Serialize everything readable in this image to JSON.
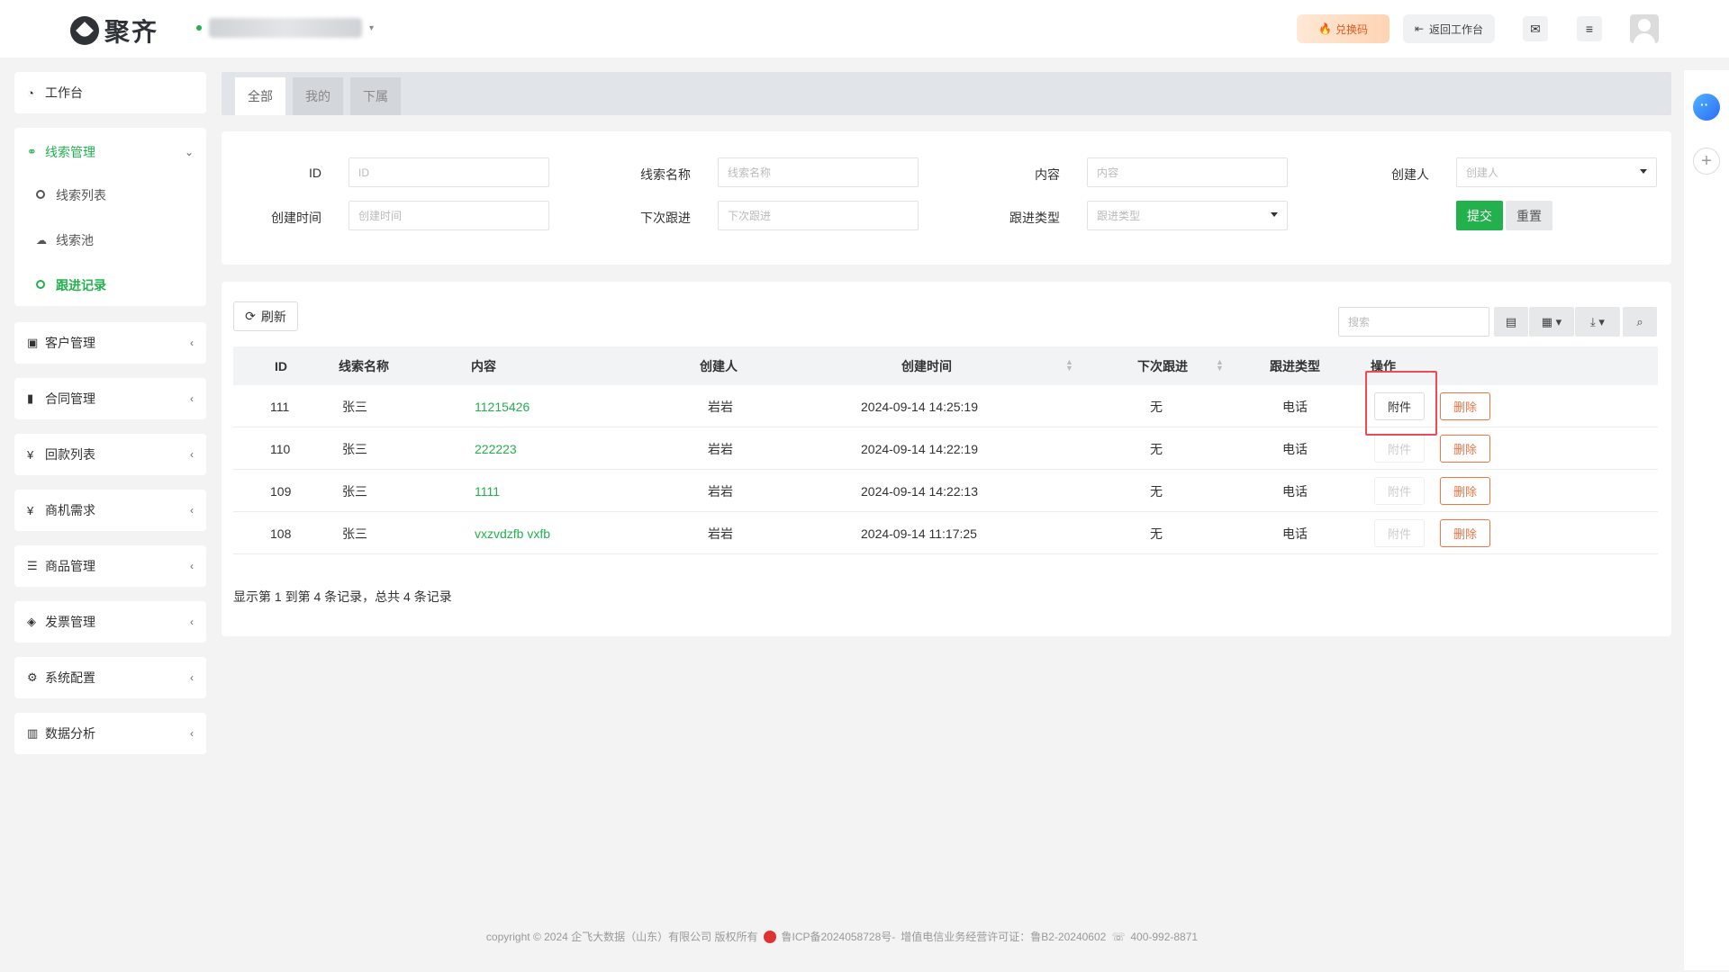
{
  "header": {
    "brand": "聚齐",
    "redeem_label": "兑换码",
    "back_label": "返回工作台"
  },
  "sidebar": {
    "workbench": "工作台",
    "leads": "线索管理",
    "leads_sub": [
      "线索列表",
      "线索池",
      "跟进记录"
    ],
    "groups": [
      "客户管理",
      "合同管理",
      "回款列表",
      "商机需求",
      "商品管理",
      "发票管理",
      "系统配置",
      "数据分析"
    ]
  },
  "tabs": [
    "全部",
    "我的",
    "下属"
  ],
  "filter": {
    "id_label": "ID",
    "id_placeholder": "ID",
    "name_label": "线索名称",
    "name_placeholder": "线索名称",
    "content_label": "内容",
    "content_placeholder": "内容",
    "creator_label": "创建人",
    "creator_placeholder": "创建人",
    "created_label": "创建时间",
    "created_placeholder": "创建时间",
    "next_label": "下次跟进",
    "next_placeholder": "下次跟进",
    "type_label": "跟进类型",
    "type_placeholder": "跟进类型",
    "submit": "提交",
    "reset": "重置"
  },
  "toolbar": {
    "refresh": "刷新",
    "search_placeholder": "搜索"
  },
  "table": {
    "columns": [
      "ID",
      "线索名称",
      "内容",
      "创建人",
      "创建时间",
      "下次跟进",
      "跟进类型",
      "操作"
    ],
    "rows": [
      {
        "id": "111",
        "name": "张三",
        "content": "11215426",
        "creator": "岩岩",
        "created": "2024-09-14 14:25:19",
        "next": "无",
        "type": "电话",
        "attach": "附件",
        "delete": "删除"
      },
      {
        "id": "110",
        "name": "张三",
        "content": "222223",
        "creator": "岩岩",
        "created": "2024-09-14 14:22:19",
        "next": "无",
        "type": "电话",
        "attach": "附件",
        "delete": "删除"
      },
      {
        "id": "109",
        "name": "张三",
        "content": "1111",
        "creator": "岩岩",
        "created": "2024-09-14 14:22:13",
        "next": "无",
        "type": "电话",
        "attach": "附件",
        "delete": "删除"
      },
      {
        "id": "108",
        "name": "张三",
        "content": "vxzvdzfb vxfb",
        "creator": "岩岩",
        "created": "2024-09-14 11:17:25",
        "next": "无",
        "type": "电话",
        "attach": "附件",
        "delete": "删除"
      }
    ],
    "summary": "显示第 1 到第 4 条记录，总共 4 条记录"
  },
  "footer": {
    "copyright": "copyright © 2024 企飞大数据（山东）有限公司 版权所有",
    "icp": "鲁ICP备2024058728号-",
    "license": "增值电信业务经营许可证：鲁B2-20240602",
    "phone": "400-992-8871"
  },
  "colors": {
    "accent": "#23b14d",
    "danger": "#f07445",
    "highlight": "#f04a5a"
  }
}
